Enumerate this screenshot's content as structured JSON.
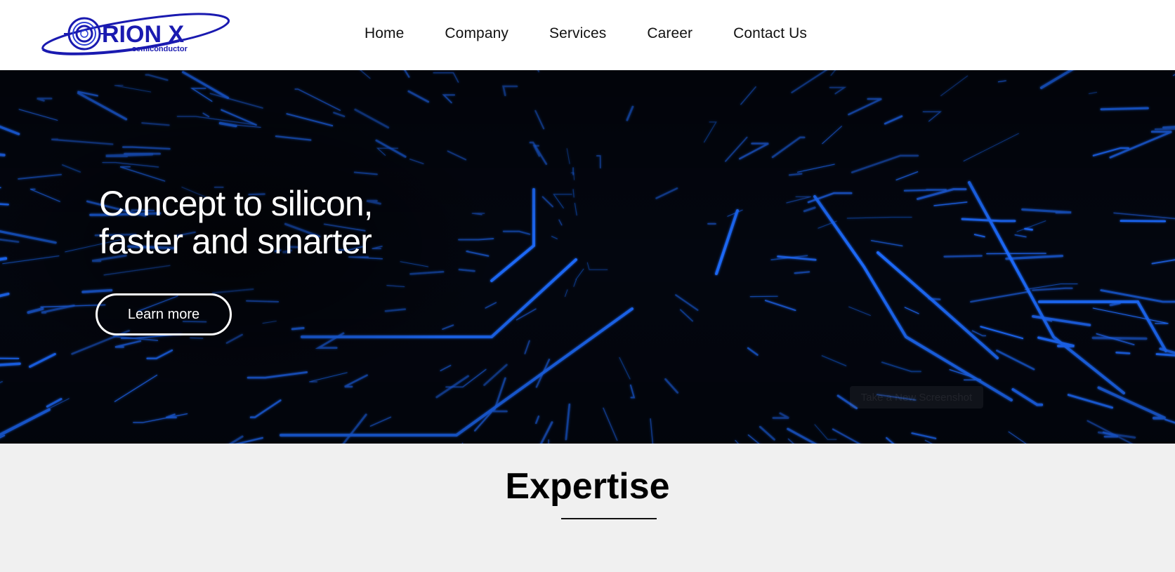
{
  "brand": {
    "logo_text": "RION X",
    "logo_subtext": "semiconductor",
    "logo_color": "#1a1ab0",
    "logo_accent": "#2b3fd6"
  },
  "nav": {
    "items": [
      "Home",
      "Company",
      "Services",
      "Career",
      "Contact Us"
    ]
  },
  "hero": {
    "title_line1": "Concept to silicon,",
    "title_line2": "faster and smarter",
    "cta_label": "Learn more",
    "tooltip_text": "Take a New Screenshot",
    "circuit_color": "#1e6bff"
  },
  "expertise": {
    "title": "Expertise"
  }
}
